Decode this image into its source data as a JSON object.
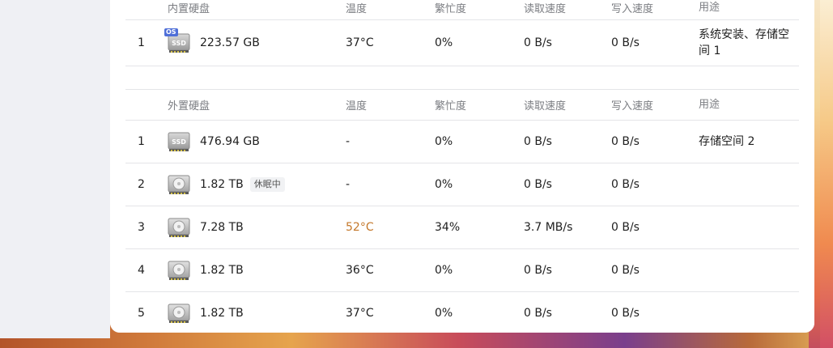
{
  "internal": {
    "header": {
      "disk": "内置硬盘",
      "temp": "温度",
      "busy": "繁忙度",
      "read": "读取速度",
      "write": "写入速度",
      "use": "用途"
    },
    "rows": [
      {
        "idx": "1",
        "type": "SSD",
        "os_badge": "OS",
        "capacity": "223.57 GB",
        "temp": "37°C",
        "busy": "0%",
        "read": "0 B/s",
        "write": "0 B/s",
        "use": "系统安装、存储空间 1"
      }
    ]
  },
  "external": {
    "header": {
      "disk": "外置硬盘",
      "temp": "温度",
      "busy": "繁忙度",
      "read": "读取速度",
      "write": "写入速度",
      "use": "用途"
    },
    "rows": [
      {
        "idx": "1",
        "type": "SSD",
        "capacity": "476.94 GB",
        "temp": "-",
        "busy": "0%",
        "read": "0 B/s",
        "write": "0 B/s",
        "use": "存储空间 2"
      },
      {
        "idx": "2",
        "type": "HDD",
        "capacity": "1.82 TB",
        "status": "休眠中",
        "temp": "-",
        "busy": "0%",
        "read": "0 B/s",
        "write": "0 B/s",
        "use": ""
      },
      {
        "idx": "3",
        "type": "HDD",
        "capacity": "7.28 TB",
        "temp": "52°C",
        "busy": "34%",
        "read": "3.7 MB/s",
        "write": "0 B/s",
        "use": ""
      },
      {
        "idx": "4",
        "type": "HDD",
        "capacity": "1.82 TB",
        "temp": "36°C",
        "busy": "0%",
        "read": "0 B/s",
        "write": "0 B/s",
        "use": ""
      },
      {
        "idx": "5",
        "type": "HDD",
        "capacity": "1.82 TB",
        "temp": "37°C",
        "busy": "0%",
        "read": "0 B/s",
        "write": "0 B/s",
        "use": ""
      }
    ]
  },
  "colors": {
    "warn_temp": "#c4782b",
    "os_badge": "#4f6fd8"
  },
  "icons": {
    "ssd": "ssd-drive-icon",
    "hdd": "hdd-drive-icon"
  }
}
